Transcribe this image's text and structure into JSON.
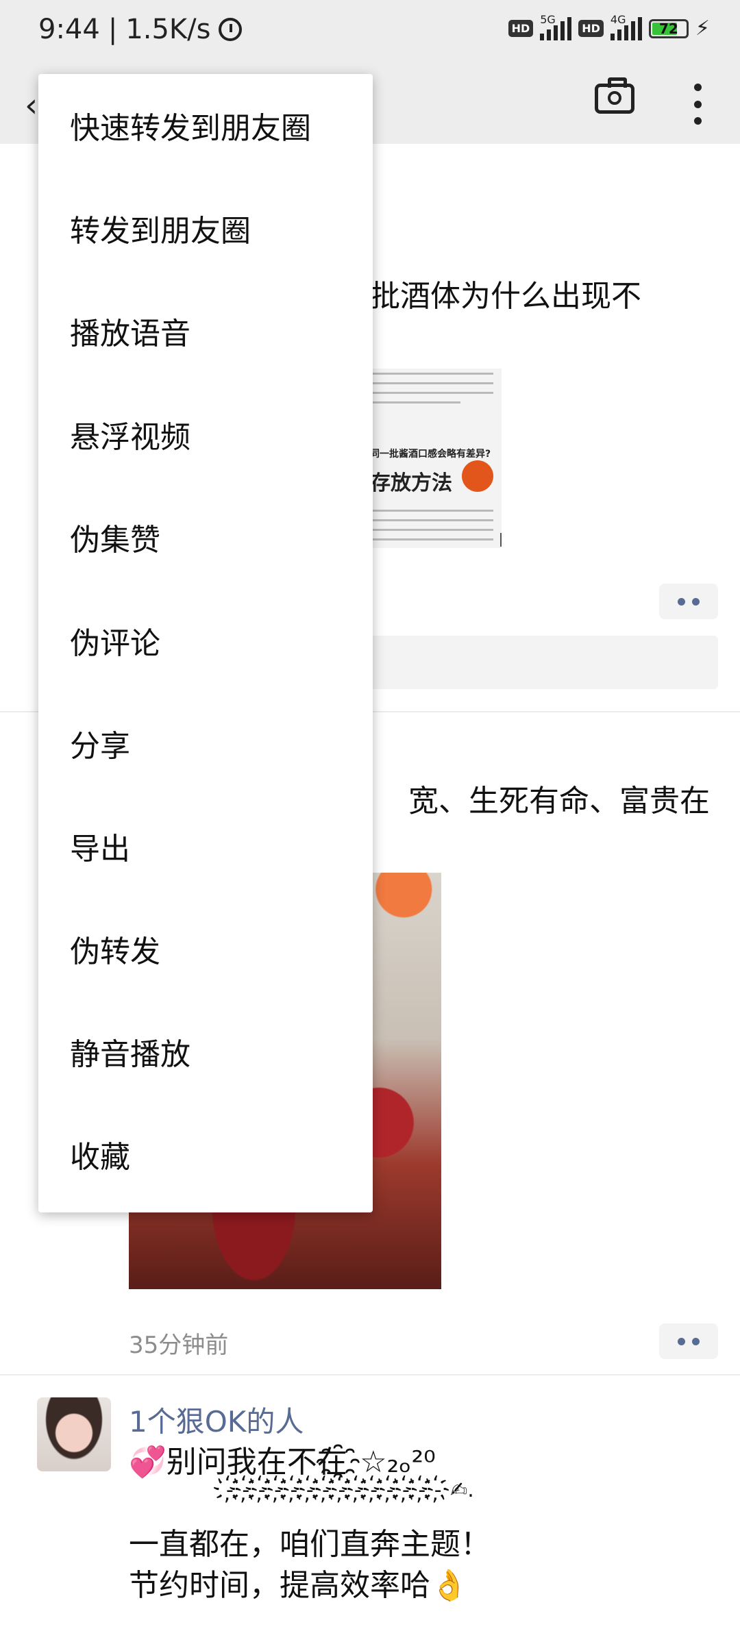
{
  "status_bar": {
    "time": "9:44",
    "net_speed": "1.5K/s",
    "net_1": "5G",
    "net_2": "4G",
    "hd": "HD",
    "battery": "72"
  },
  "feed": {
    "post1_text_fragment": "一批酒体为什么出现不",
    "post1_image": {
      "question": "同一批酱酒口感会略有差异?",
      "heading": "存放方法"
    },
    "post2_text_fragment": "宽、生死有命、富贵在",
    "post2_time": "35分钟前",
    "post3": {
      "username": "1个狠OK的人",
      "line1": "💞别问我在不在҈☆₂ₒ²⁰",
      "line2": "-҉-҉-҉-҉-҉-҉-҉-҉-҉-҉-҉-҉-҉-҉✍.",
      "line3": "一直都在，咱们直奔主题！",
      "line4": "节约时间，提高效率哈👌"
    }
  },
  "menu": {
    "items": [
      "快速转发到朋友圈",
      "转发到朋友圈",
      "播放语音",
      "悬浮视频",
      "伪集赞",
      "伪评论",
      "分享",
      "导出",
      "伪转发",
      "静音播放",
      "收藏"
    ]
  }
}
